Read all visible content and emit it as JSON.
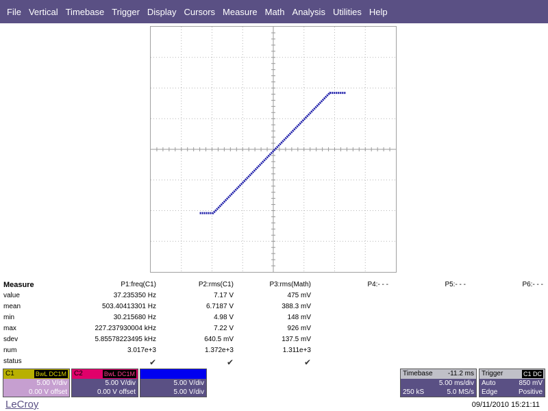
{
  "menu": [
    "File",
    "Vertical",
    "Timebase",
    "Trigger",
    "Display",
    "Cursors",
    "Measure",
    "Math",
    "Analysis",
    "Utilities",
    "Help"
  ],
  "measure": {
    "title": "Measure",
    "columns": [
      "P1:freq(C1)",
      "P2:rms(C1)",
      "P3:rms(Math)",
      "P4:- - -",
      "P5:- - -",
      "P6:- - -"
    ],
    "rows": [
      {
        "label": "value",
        "cells": [
          "37.235350 Hz",
          "7.17 V",
          "475 mV"
        ]
      },
      {
        "label": "mean",
        "cells": [
          "503.40413301 Hz",
          "6.7187 V",
          "388.3 mV"
        ]
      },
      {
        "label": "min",
        "cells": [
          "30.215680 Hz",
          "4.98 V",
          "148 mV"
        ]
      },
      {
        "label": "max",
        "cells": [
          "227.237930004 kHz",
          "7.22 V",
          "926 mV"
        ]
      },
      {
        "label": "sdev",
        "cells": [
          "5.85578223495 kHz",
          "640.5 mV",
          "137.5 mV"
        ]
      },
      {
        "label": "num",
        "cells": [
          "3.017e+3",
          "1.372e+3",
          "1.311e+3"
        ]
      },
      {
        "label": "status",
        "cells": [
          "✔",
          "✔",
          "✔"
        ]
      }
    ]
  },
  "channels": [
    {
      "name": "C1",
      "tags": "BwL DC1M",
      "vdiv": "5.00 V/div",
      "offset": "0.00 V offset"
    },
    {
      "name": "C2",
      "tags": "BwL DC1M",
      "vdiv": "5.00 V/div",
      "offset": "0.00 V offset"
    },
    {
      "name": "",
      "tags": "",
      "vdiv": "5.00 V/div",
      "offset": "5.00 V/div"
    }
  ],
  "timebase": {
    "label": "Timebase",
    "delay": "-11.2 ms",
    "tdiv": "5.00 ms/div",
    "samples": "250 kS",
    "rate": "5.0 MS/s"
  },
  "trigger": {
    "label": "Trigger",
    "tags": "C1 DC",
    "mode": "Auto",
    "level": "850 mV",
    "type": "Edge",
    "slope": "Positive"
  },
  "brand": "LeCroy",
  "datetime": "09/11/2010 15:21:11",
  "colors": {
    "menu_bg": "#5a5084",
    "trace": "#1a1aa8",
    "grid": "#b4b4b4"
  },
  "trace": {
    "x_range": [
      -5,
      5
    ],
    "y_range": [
      -5,
      5
    ],
    "points": [
      [
        -3.0,
        -2.6
      ],
      [
        -2.45,
        -2.6
      ],
      [
        2.3,
        2.3
      ],
      [
        2.95,
        2.3
      ]
    ]
  }
}
